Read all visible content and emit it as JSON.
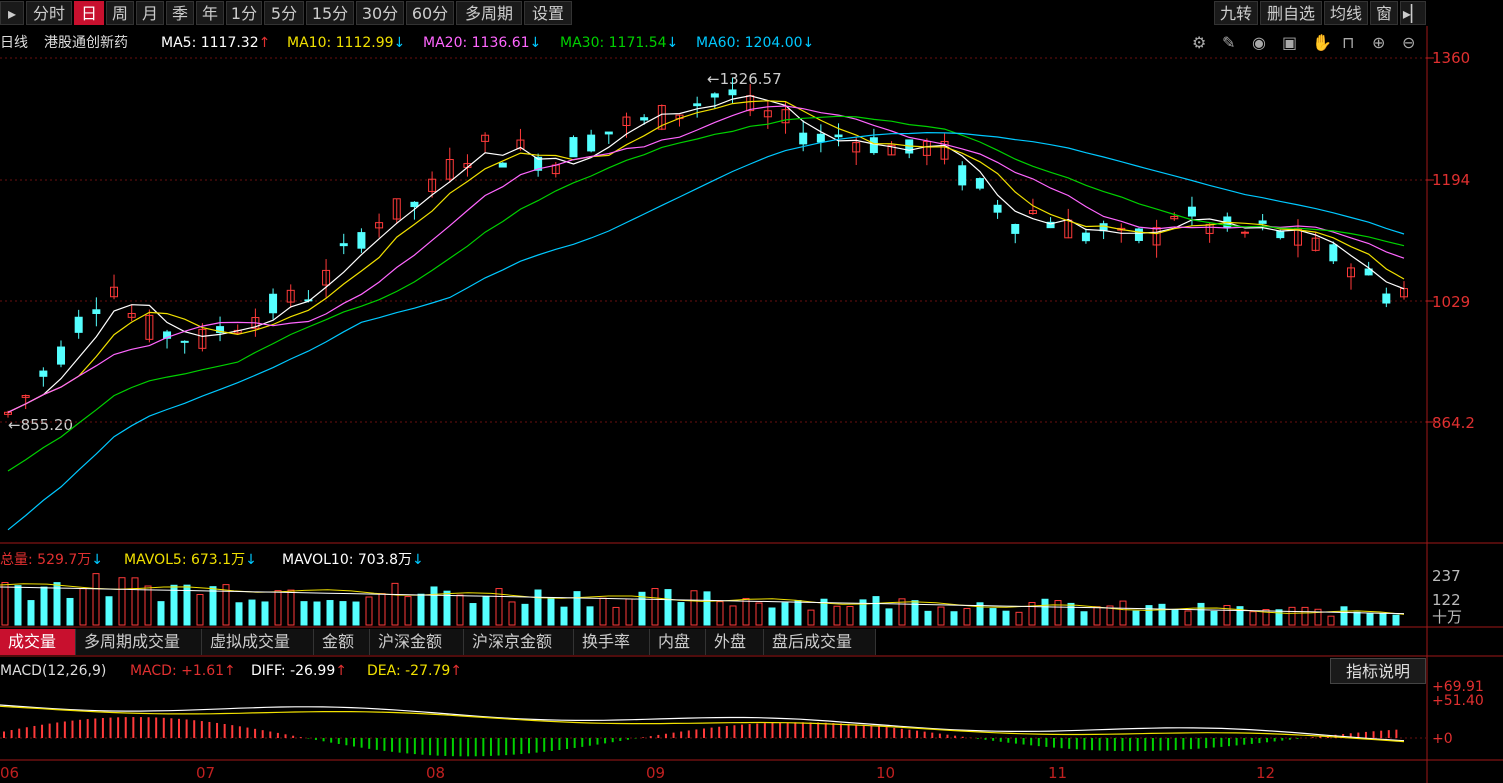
{
  "toolbar": {
    "left_icon": "collapse-left-icon",
    "periods": [
      "分时",
      "日",
      "周",
      "月",
      "季",
      "年",
      "1分",
      "5分",
      "15分",
      "30分",
      "60分",
      "多周期",
      "设置"
    ],
    "active_period": "日",
    "right_items": [
      "九转",
      "删自选",
      "均线",
      "窗"
    ],
    "right_icon": "collapse-right-icon"
  },
  "main": {
    "period_label": "日线",
    "stock_name": "港股通创新药",
    "ma": [
      {
        "label": "MA5: 1117.32",
        "arrow": "↑",
        "color": "#ffffff"
      },
      {
        "label": "MA10: 1112.99",
        "arrow": "↓",
        "color": "#f0e000"
      },
      {
        "label": "MA20: 1136.61",
        "arrow": "↓",
        "color": "#ff66ff"
      },
      {
        "label": "MA30: 1171.54",
        "arrow": "↓",
        "color": "#00d000"
      },
      {
        "label": "MA60: 1204.00",
        "arrow": "↓",
        "color": "#00c8ff"
      }
    ],
    "tool_icons": [
      "settings-icon",
      "draw-icon",
      "eye-icon",
      "bag-icon",
      "hand-icon",
      "lock-icon",
      "zoom-in-icon",
      "zoom-out-icon"
    ],
    "y_axis": [
      "1360",
      "1194",
      "1029",
      "864.2"
    ],
    "high_marker": "1326.57",
    "low_marker": "855.20"
  },
  "volume": {
    "total_label": "总量: 529.7万",
    "total_arrow": "↓",
    "mavol5": "MAVOL5: 673.1万",
    "mavol5_arrow": "↓",
    "mavol10": "MAVOL10: 703.8万",
    "mavol10_arrow": "↓",
    "y_axis": [
      "237",
      "122",
      "十万"
    ]
  },
  "sub_tabs": [
    "成交量",
    "多周期成交量",
    "虚拟成交量",
    "金额",
    "沪深金额",
    "沪深京金额",
    "换手率",
    "内盘",
    "外盘",
    "盘后成交量"
  ],
  "active_sub_tab": "成交量",
  "macd": {
    "title": "MACD(12,26,9)",
    "macd": "MACD: +1.61",
    "macd_arrow": "↑",
    "diff": "DIFF: -26.99",
    "diff_arrow": "↑",
    "dea": "DEA: -27.79",
    "dea_arrow": "↑",
    "help_button": "指标说明",
    "y_axis": [
      "+69.91",
      "+51.40",
      "+0"
    ]
  },
  "x_axis_months": [
    "06",
    "07",
    "08",
    "09",
    "10",
    "11",
    "12"
  ],
  "chart_data": {
    "type": "candlestick",
    "ylim": [
      770,
      1400
    ],
    "x_ticks": [
      "06",
      "07",
      "08",
      "09",
      "10",
      "11",
      "12"
    ],
    "ma_close_trend": [
      875,
      900,
      930,
      960,
      1000,
      1030,
      1050,
      1010,
      990,
      985,
      980,
      975,
      990,
      1000,
      1010,
      1020,
      1030,
      1040,
      1060,
      1090,
      1120,
      1140,
      1150,
      1160,
      1180,
      1210,
      1230,
      1240,
      1230,
      1235,
      1225,
      1220,
      1240,
      1250,
      1260,
      1270,
      1270,
      1280,
      1290,
      1300,
      1310,
      1310,
      1290,
      1280,
      1270,
      1260,
      1250,
      1255,
      1250,
      1245,
      1240,
      1230,
      1240,
      1230,
      1200,
      1180,
      1160,
      1140,
      1150,
      1140,
      1130,
      1120,
      1125,
      1110,
      1115,
      1120,
      1150,
      1140,
      1130,
      1125,
      1120,
      1125,
      1120,
      1110,
      1100,
      1090,
      1080,
      1060,
      1040,
      1045
    ]
  }
}
